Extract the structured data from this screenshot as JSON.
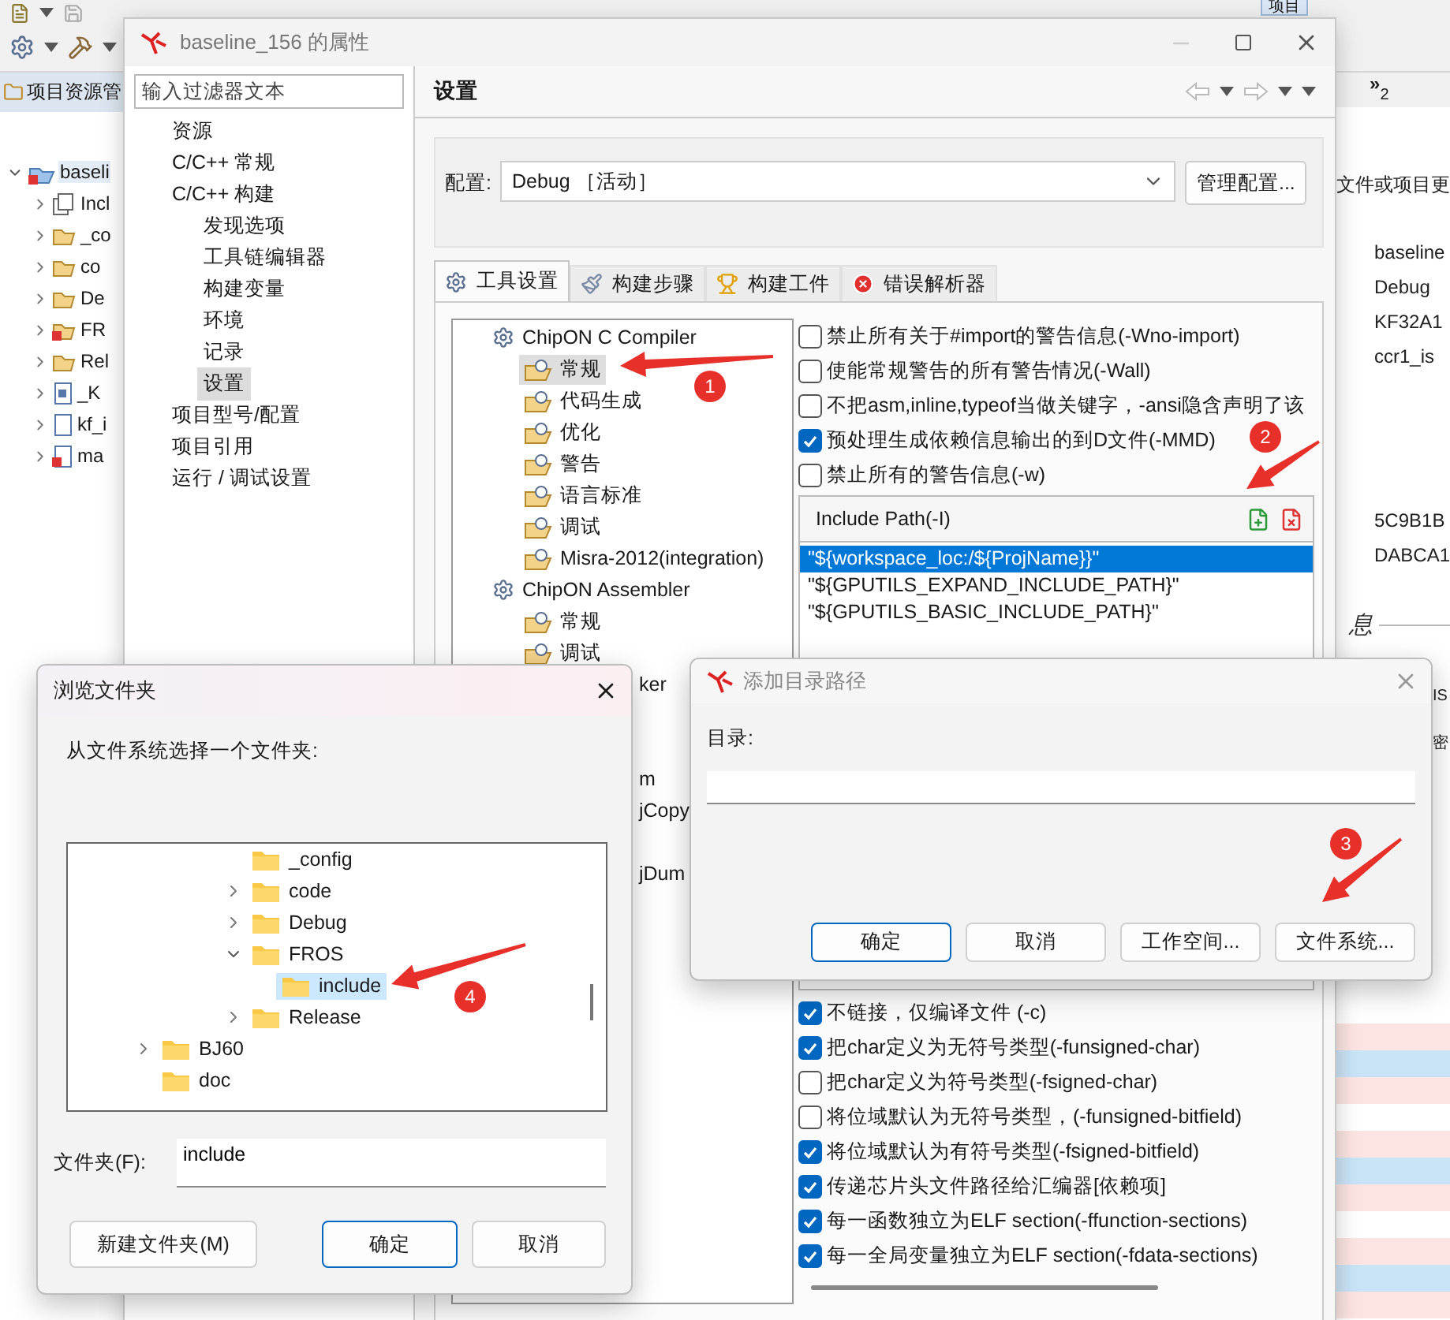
{
  "toolbar": {
    "tab": "项目"
  },
  "explorer": {
    "title": "项目资源管",
    "items": [
      {
        "label": "baseli",
        "kind": "project",
        "expanded": true,
        "selected": true,
        "children": [
          {
            "label": "Incl",
            "kind": "includes",
            "expanded": false,
            "selected": false
          },
          {
            "label": "_co",
            "kind": "folder",
            "expanded": false,
            "selected": false
          },
          {
            "label": "co",
            "kind": "folder",
            "expanded": false,
            "selected": false
          },
          {
            "label": "De",
            "kind": "folder",
            "expanded": false,
            "selected": false
          },
          {
            "label": "FR",
            "kind": "error-folder",
            "expanded": false,
            "selected": false
          },
          {
            "label": "Rel",
            "kind": "folder",
            "expanded": false,
            "selected": false
          },
          {
            "label": "_K",
            "kind": "header",
            "expanded": false,
            "selected": false
          },
          {
            "label": "kf_i",
            "kind": "source",
            "expanded": false,
            "selected": false
          },
          {
            "label": "ma",
            "kind": "error-source",
            "expanded": false,
            "selected": false
          }
        ]
      }
    ]
  },
  "side_panel": {
    "overflow_tab": {
      "label": "»",
      "count": "2"
    },
    "heading": "文件或项目更",
    "values": [
      "baseline",
      "Debug",
      "KF32A1",
      "ccr1_is"
    ],
    "ids": [
      "5C9B1B",
      "DABCA1"
    ],
    "section": "息",
    "fragments": [
      "IS",
      "密"
    ]
  },
  "properties": {
    "title": "baseline_156 的属性",
    "filter": {
      "placeholder": "输入过滤器文本"
    },
    "nav": [
      {
        "label": "资源",
        "selected": false
      },
      {
        "label": "C/C++ 常规",
        "selected": false
      },
      {
        "label": "C/C++ 构建",
        "selected": false,
        "children": [
          {
            "label": "发现选项",
            "selected": false
          },
          {
            "label": "工具链编辑器",
            "selected": false
          },
          {
            "label": "构建变量",
            "selected": false
          },
          {
            "label": "环境",
            "selected": false
          },
          {
            "label": "记录",
            "selected": false
          },
          {
            "label": "设置",
            "selected": true
          }
        ]
      },
      {
        "label": "项目型号/配置",
        "selected": false
      },
      {
        "label": "项目引用",
        "selected": false
      },
      {
        "label": "运行 / 调试设置",
        "selected": false
      }
    ],
    "page_title": "设置",
    "config": {
      "label": "配置:",
      "value": "Debug ［活动］",
      "button": "管理配置..."
    },
    "tabs": [
      {
        "label": "工具设置",
        "selected": true
      },
      {
        "label": "构建步骤",
        "selected": false
      },
      {
        "label": "构建工件",
        "selected": false
      },
      {
        "label": "错误解析器",
        "selected": false
      }
    ],
    "tool_tree": [
      {
        "label": "ChipON C Compiler",
        "selected": false,
        "children": [
          {
            "label": "常规",
            "selected": true
          },
          {
            "label": "代码生成",
            "selected": false
          },
          {
            "label": "优化",
            "selected": false
          },
          {
            "label": "警告",
            "selected": false
          },
          {
            "label": "语言标准",
            "selected": false
          },
          {
            "label": "调试",
            "selected": false
          },
          {
            "label": "Misra-2012(integration)",
            "selected": false
          }
        ]
      },
      {
        "label": "ChipON Assembler",
        "selected": false,
        "children": [
          {
            "label": "常规",
            "selected": false
          },
          {
            "label": "调试",
            "selected": false
          }
        ]
      }
    ],
    "tool_tree_fragments": [
      "ker",
      "m",
      "jCopy",
      "jDum"
    ],
    "options_top": [
      {
        "label": "禁止所有关于#import的警告信息(-Wno-import)",
        "checked": false
      },
      {
        "label": "使能常规警告的所有警告情况(-Wall)",
        "checked": false
      },
      {
        "label": "不把asm,inline,typeof当做关键字，-ansi隐含声明了该",
        "checked": false
      },
      {
        "label": "预处理生成依赖信息输出的到D文件(-MMD)",
        "checked": true
      },
      {
        "label": "禁止所有的警告信息(-w)",
        "checked": false
      }
    ],
    "include_path": {
      "title": "Include Path(-I)",
      "items": [
        {
          "label": "\"${workspace_loc:/${ProjName}}\"",
          "selected": true
        },
        {
          "label": "\"${GPUTILS_EXPAND_INCLUDE_PATH}\"",
          "selected": false
        },
        {
          "label": "\"${GPUTILS_BASIC_INCLUDE_PATH}\"",
          "selected": false
        }
      ]
    },
    "options_bottom": [
      {
        "label": "不链接，仅编译文件 (-c)",
        "checked": true
      },
      {
        "label": "把char定义为无符号类型(-funsigned-char)",
        "checked": true
      },
      {
        "label": "把char定义为符号类型(-fsigned-char)",
        "checked": false
      },
      {
        "label": "将位域默认为无符号类型，(-funsigned-bitfield)",
        "checked": false
      },
      {
        "label": "将位域默认为有符号类型(-fsigned-bitfield)",
        "checked": true
      },
      {
        "label": "传递芯片头文件路径给汇编器[依赖项]",
        "checked": true
      },
      {
        "label": "每一函数独立为ELF section(-ffunction-sections)",
        "checked": true
      },
      {
        "label": "每一全局变量独立为ELF section(-fdata-sections)",
        "checked": true
      }
    ]
  },
  "browse_dialog": {
    "title": "浏览文件夹",
    "prompt": "从文件系统选择一个文件夹:",
    "tree": [
      {
        "children": [
          {
            "label": "_config",
            "has_children": false,
            "selected": false
          },
          {
            "label": "code",
            "has_children": true,
            "expanded": false,
            "selected": false
          },
          {
            "label": "Debug",
            "has_children": true,
            "expanded": false,
            "selected": false
          },
          {
            "label": "FROS",
            "has_children": true,
            "expanded": true,
            "selected": false,
            "children": [
              {
                "label": "include",
                "has_children": false,
                "selected": true
              }
            ]
          },
          {
            "label": "Release",
            "has_children": true,
            "expanded": false,
            "selected": false
          }
        ]
      },
      {
        "label": "BJ60",
        "has_children": true,
        "expanded": false,
        "selected": false
      },
      {
        "label": "doc",
        "has_children": false,
        "selected": false
      }
    ],
    "folder": {
      "label": "文件夹(F):",
      "value": "include"
    },
    "buttons": [
      {
        "label": "新建文件夹(M)",
        "default": false
      },
      {
        "label": "确定",
        "default": true
      },
      {
        "label": "取消",
        "default": false
      }
    ]
  },
  "add_dialog": {
    "title": "添加目录路径",
    "label": "目录:",
    "buttons": [
      {
        "label": "确定",
        "default": true
      },
      {
        "label": "取消",
        "default": false
      },
      {
        "label": "工作空间...",
        "default": false
      },
      {
        "label": "文件系统...",
        "default": false
      }
    ]
  },
  "annotations": [
    {
      "number": "1"
    },
    {
      "number": "2"
    },
    {
      "number": "3"
    },
    {
      "number": "4"
    }
  ]
}
